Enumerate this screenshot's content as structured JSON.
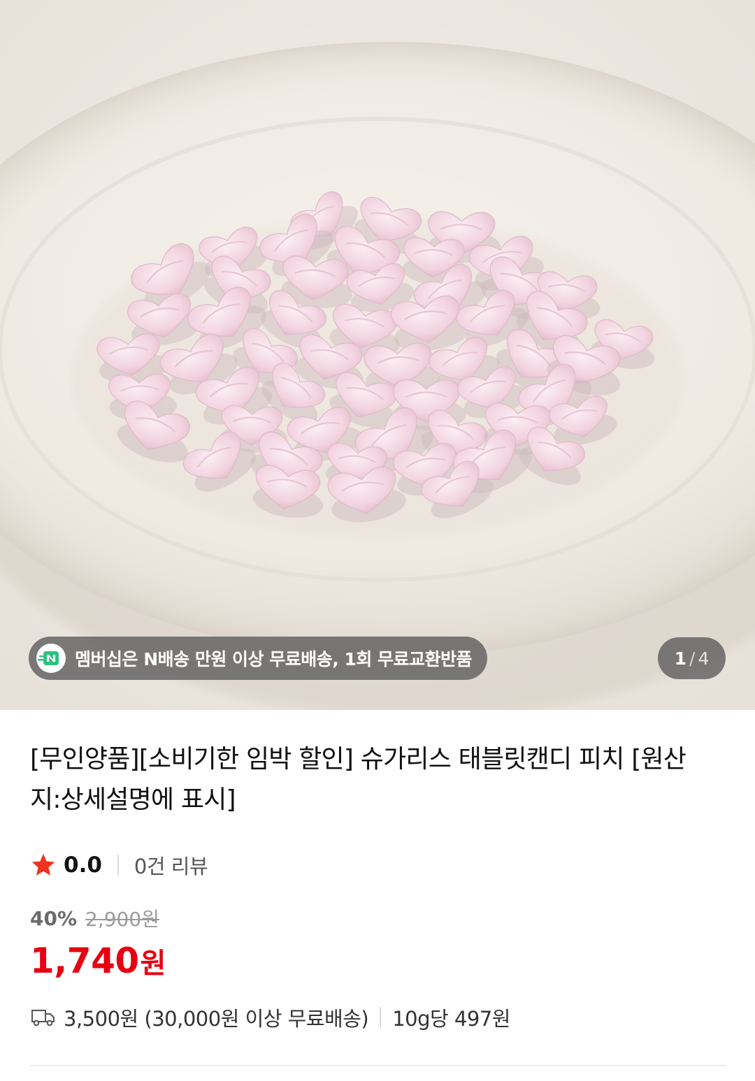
{
  "product_gallery": {
    "image_alt_icon": "product-photo-pink-heart-tablet-candies-on-white-plate",
    "membership_badge": {
      "icon": "n-delivery-icon",
      "text": "멤버십은 N배송 만원 이상 무료배송, 1회 무료교환반품"
    },
    "page_counter": {
      "current": "1",
      "separator": "/",
      "total": "4"
    }
  },
  "product": {
    "title": "[무인양품][소비기한 임박 할인] 슈가리스 태블릿캔디 피치 [원산지:상세설명에 표시]",
    "rating": {
      "icon": "star-icon",
      "score": "0.0",
      "reviews": "0건 리뷰"
    },
    "discount": {
      "rate": "40%",
      "original_price": "2,900원"
    },
    "price": {
      "amount": "1,740",
      "unit": "원"
    },
    "shipping": {
      "icon": "truck-icon",
      "fee_text": "3,500원 (30,000원 이상 무료배송)",
      "unit_price": "10g당 497원"
    }
  },
  "colors": {
    "price_red": "#e60012",
    "star_red": "#f0321e",
    "badge_bg": "#5a5a5a",
    "n_icon_green": "#2ec27e"
  }
}
